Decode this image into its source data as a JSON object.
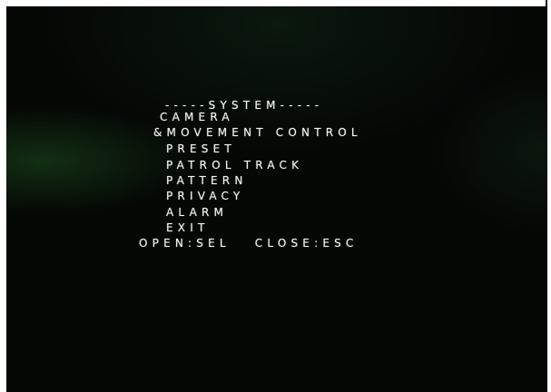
{
  "osd_menu": {
    "title": "-----SYSTEM-----",
    "items": [
      {
        "label": "CAMERA"
      },
      {
        "label": "&MOVEMENT CONTROL"
      },
      {
        "label": "PRESET"
      },
      {
        "label": "PATROL TRACK"
      },
      {
        "label": "PATTERN"
      },
      {
        "label": "PRIVACY"
      },
      {
        "label": "ALARM"
      },
      {
        "label": "EXIT"
      }
    ],
    "footer": "OPEN:SEL   CLOSE:ESC"
  },
  "colors": {
    "background": "#050705",
    "text": "#f2f2f2"
  }
}
